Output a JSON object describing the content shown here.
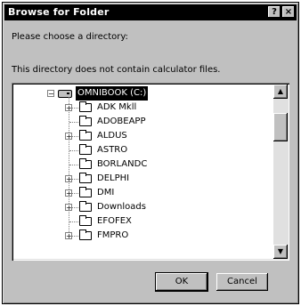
{
  "window": {
    "title": "Browse for Folder"
  },
  "titlebar_buttons": {
    "help": "?",
    "close": "×"
  },
  "prompt": "Please choose a directory:",
  "message": "This directory does not contain calculator files.",
  "tree": {
    "root": {
      "label": "OMNIBOOK (C:)",
      "icon": "drive-icon",
      "selected": true
    },
    "items": [
      {
        "label": "ADK Mkll",
        "expandable": true
      },
      {
        "label": "ADOBEAPP",
        "expandable": false
      },
      {
        "label": "ALDUS",
        "expandable": true
      },
      {
        "label": "ASTRO",
        "expandable": false
      },
      {
        "label": "BORLANDC",
        "expandable": false
      },
      {
        "label": "DELPHI",
        "expandable": true
      },
      {
        "label": "DMI",
        "expandable": true
      },
      {
        "label": "Downloads",
        "expandable": true
      },
      {
        "label": "EFOFEX",
        "expandable": false
      },
      {
        "label": "FMPRO",
        "expandable": true
      }
    ]
  },
  "scrollbar": {
    "up": "▲",
    "down": "▼",
    "position": 0.12
  },
  "buttons": {
    "ok": "OK",
    "cancel": "Cancel"
  }
}
